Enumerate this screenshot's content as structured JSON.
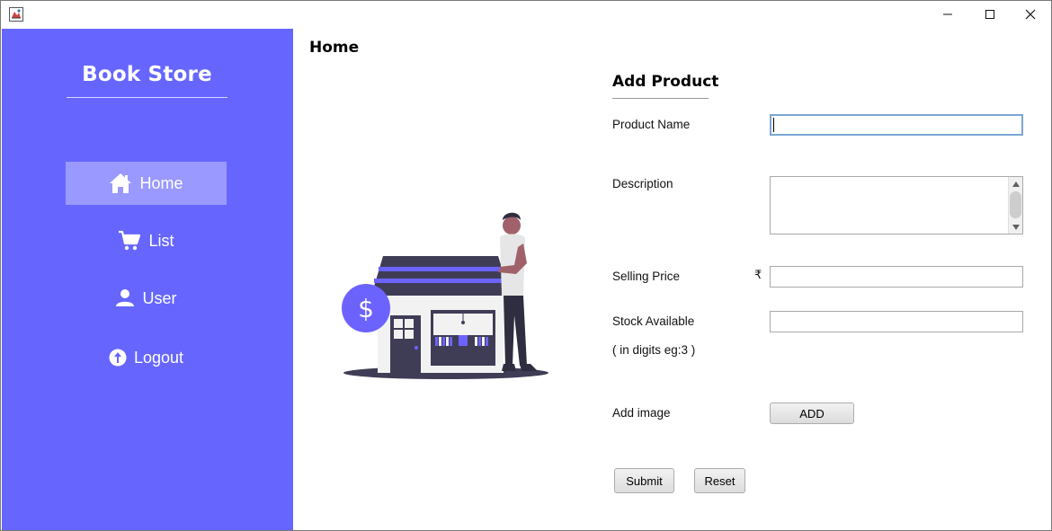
{
  "window": {
    "controls": {
      "minimize_icon": "minimize-icon",
      "maximize_icon": "maximize-icon",
      "close_icon": "close-icon"
    }
  },
  "sidebar": {
    "brand": "Book Store",
    "bg_color": "#6666ff",
    "active_color": "#9999ff",
    "items": [
      {
        "label": "Home",
        "icon": "home-icon",
        "active": true
      },
      {
        "label": "List",
        "icon": "cart-icon",
        "active": false
      },
      {
        "label": "User",
        "icon": "user-icon",
        "active": false
      },
      {
        "label": "Logout",
        "icon": "logout-icon",
        "active": false
      }
    ]
  },
  "main": {
    "title": "Home",
    "illustration": "store-illustration"
  },
  "form": {
    "title": "Add Product",
    "product_name": {
      "label": "Product Name",
      "value": ""
    },
    "description": {
      "label": "Description",
      "value": ""
    },
    "selling_price": {
      "label": "Selling Price",
      "currency": "₹",
      "value": ""
    },
    "stock": {
      "label": "Stock Available",
      "hint": "( in digits eg:3 )",
      "value": ""
    },
    "image": {
      "label": "Add image",
      "button": "ADD"
    },
    "submit": "Submit",
    "reset": "Reset"
  }
}
